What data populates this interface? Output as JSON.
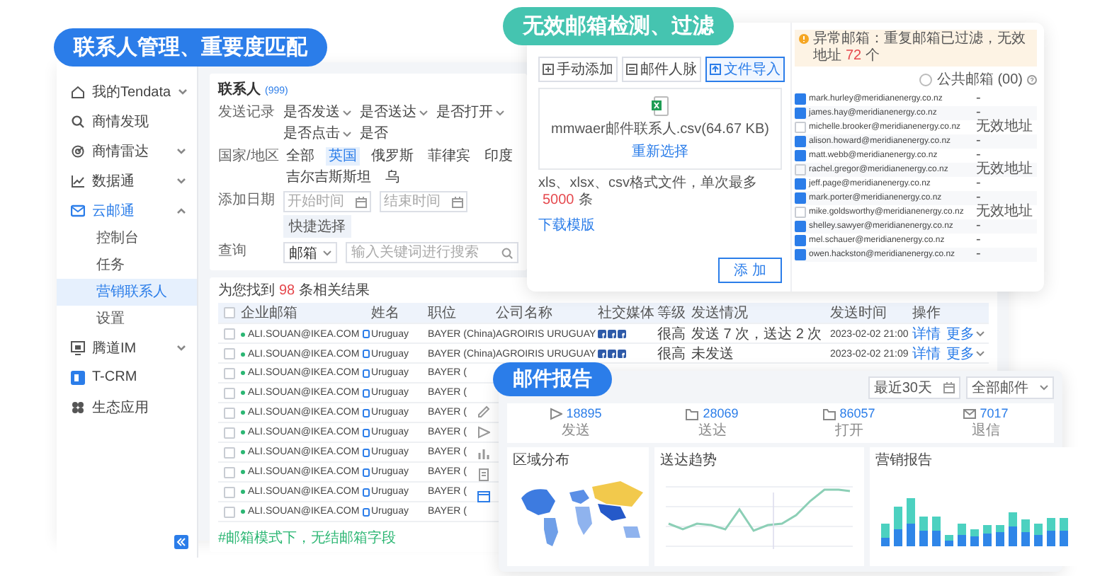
{
  "contact_bubble": {
    "label": "联系人管理、重要度匹配"
  },
  "sidebar": {
    "items": [
      {
        "label": "我的Tendata",
        "expanded": false,
        "selected": false
      },
      {
        "label": "商情发现",
        "selected": false
      },
      {
        "label": "商情雷达",
        "expanded": false,
        "selected": false
      },
      {
        "label": "数据通",
        "expanded": false,
        "selected": false
      },
      {
        "label": "云邮通",
        "expanded": true,
        "selected": true,
        "children": [
          {
            "label": "控制台",
            "selected": false
          },
          {
            "label": "任务",
            "selected": false
          },
          {
            "label": "营销联系人",
            "selected": true
          },
          {
            "label": "设置",
            "selected": false
          }
        ]
      },
      {
        "label": "腾道IM",
        "expanded": false,
        "selected": false
      },
      {
        "label": "T-CRM",
        "selected": false
      },
      {
        "label": "生态应用",
        "selected": false
      }
    ]
  },
  "contacts": {
    "title": "联系人",
    "count": "(999)",
    "filters": [
      {
        "kind": "dropdowns",
        "label": "发送记录",
        "options": [
          {
            "label": "是否发送",
            "dropdown": true
          },
          {
            "label": "是否送达",
            "dropdown": true
          },
          {
            "label": "是否打开",
            "dropdown": true
          },
          {
            "label": "是否点击",
            "dropdown": true
          },
          {
            "label": "是否",
            "dropdown": false
          }
        ]
      },
      {
        "kind": "chips",
        "label": "国家/地区",
        "options": [
          {
            "label": "全部",
            "selected": false
          },
          {
            "label": "英国",
            "selected": true
          },
          {
            "label": "俄罗斯",
            "selected": false
          },
          {
            "label": "菲律宾",
            "selected": false
          },
          {
            "label": "印度",
            "selected": false
          },
          {
            "label": "吉尔吉斯斯坦",
            "selected": false
          },
          {
            "label": "乌",
            "selected": false
          }
        ]
      },
      {
        "kind": "dates",
        "label": "添加日期",
        "start_placeholder": "开始时间",
        "end_placeholder": "结束时间",
        "button": "快捷选择"
      },
      {
        "kind": "search",
        "label": "查询",
        "select": "邮箱",
        "placeholder": "输入关键词进行搜索"
      }
    ],
    "results": {
      "prefix": "为您找到",
      "count": "98",
      "suffix": "条相关结果"
    },
    "table": {
      "header_checked": false,
      "columns": [
        "企业邮箱",
        "姓名",
        "职位",
        "公司名称",
        "社交媒体",
        "等级",
        "发送情况",
        "发送时间",
        "操作"
      ],
      "rows": [
        {
          "checked": false,
          "email": "ALI.SOUAN@IKEA.COM",
          "name": "Uruguay",
          "job": "BAYER (China)",
          "company": "AGROIRIS URUGUAY",
          "social_links": true,
          "level": "很高",
          "result": "发送 7 次，送达 2 次",
          "time": "2023-02-02 21:00",
          "actions": [
            "详情",
            "更多"
          ]
        },
        {
          "checked": false,
          "email": "ALI.SOUAN@IKEA.COM",
          "name": "Uruguay",
          "job": "BAYER (China)",
          "company": "AGROIRIS URUGUAY",
          "social_links": true,
          "level": "很高",
          "result": "未发送",
          "time": "2023-02-02 21:09",
          "actions": [
            "详情",
            "更多"
          ]
        },
        {
          "checked": false,
          "email": "ALI.SOUAN@IKEA.COM",
          "name": "Uruguay",
          "job": "BAYER ("
        },
        {
          "checked": false,
          "email": "ALI.SOUAN@IKEA.COM",
          "name": "Uruguay",
          "job": "BAYER ("
        },
        {
          "checked": false,
          "email": "ALI.SOUAN@IKEA.COM",
          "name": "Uruguay",
          "job": "BAYER ("
        },
        {
          "checked": false,
          "email": "ALI.SOUAN@IKEA.COM",
          "name": "Uruguay",
          "job": "BAYER ("
        },
        {
          "checked": false,
          "email": "ALI.SOUAN@IKEA.COM",
          "name": "Uruguay",
          "job": "BAYER ("
        },
        {
          "checked": false,
          "email": "ALI.SOUAN@IKEA.COM",
          "name": "Uruguay",
          "job": "BAYER ("
        },
        {
          "checked": false,
          "email": "ALI.SOUAN@IKEA.COM",
          "name": "Uruguay",
          "job": "BAYER ("
        },
        {
          "checked": false,
          "email": "ALI.SOUAN@IKEA.COM",
          "name": "Uruguay",
          "job": "BAYER ("
        }
      ]
    },
    "note": "#邮箱模式下，无结邮箱字段"
  },
  "import_bubble": {
    "label": "无效邮箱检测、过滤"
  },
  "import_dialog": {
    "tabs": [
      {
        "label": "手动添加",
        "selected": false
      },
      {
        "label": "邮件人脉",
        "selected": false
      },
      {
        "label": "文件导入",
        "selected": true
      }
    ],
    "file_name": "mmwaer邮件联系人.csv(64.67 KB)",
    "reselect": "重新选择",
    "format_note": {
      "prefix": "xls、xlsx、csv格式文件，单次最多",
      "count": "5000",
      "suffix": "条"
    },
    "template_link": "下载模版",
    "button": "添 加"
  },
  "email_check": {
    "warning": {
      "prefix": "异常邮箱：重复邮箱已过滤，无效地址",
      "count": "72",
      "suffix": "个"
    },
    "public_toggle": {
      "label": "公共邮箱 (00)",
      "on": false
    },
    "emails": [
      {
        "address": "mark.hurley@meridianenergy.co.nz",
        "checked": true,
        "status": "-"
      },
      {
        "address": "james.hay@meridianenergy.co.nz",
        "checked": true,
        "status": "-"
      },
      {
        "address": "michelle.brooker@meridianenergy.co.nz",
        "checked": false,
        "status": "无效地址"
      },
      {
        "address": "alison.howard@meridianenergy.co.nz",
        "checked": true,
        "status": "-"
      },
      {
        "address": "matt.webb@meridianenergy.co.nz",
        "checked": true,
        "status": "-"
      },
      {
        "address": "rachel.gregor@meridianenergy.co.nz",
        "checked": false,
        "status": "无效地址"
      },
      {
        "address": "jeff.page@meridianenergy.co.nz",
        "checked": true,
        "status": "-"
      },
      {
        "address": "mark.porter@meridianenergy.co.nz",
        "checked": true,
        "status": "-"
      },
      {
        "address": "mike.goldsworthy@meridianenergy.co.nz",
        "checked": false,
        "status": "无效地址"
      },
      {
        "address": "shelley.sawyer@meridianenergy.co.nz",
        "checked": true,
        "status": "-"
      },
      {
        "address": "mel.schauer@meridianenergy.co.nz",
        "checked": true,
        "status": "-"
      },
      {
        "address": "owen.hackston@meridianenergy.co.nz",
        "checked": true,
        "status": "-"
      }
    ]
  },
  "report_bubble": {
    "label": "邮件报告"
  },
  "report": {
    "date_range": "最近30天",
    "mail_filter": "全部邮件",
    "stats": [
      {
        "value": "18895",
        "label": "发送"
      },
      {
        "value": "28069",
        "label": "送达"
      },
      {
        "value": "86057",
        "label": "打开"
      },
      {
        "value": "7017",
        "label": "退信"
      }
    ],
    "panels": [
      {
        "kind": "map",
        "title": "区域分布"
      },
      {
        "kind": "line",
        "title": "送达趋势"
      },
      {
        "kind": "bar",
        "title": "营销报告"
      }
    ]
  }
}
